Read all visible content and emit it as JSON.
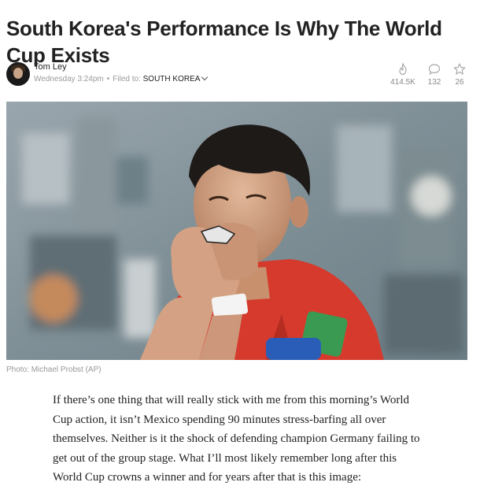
{
  "article": {
    "title": "South Korea's Performance Is Why The World Cup Exists",
    "author": "Tom Ley",
    "timestamp": "Wednesday 3:24pm",
    "separator": "•",
    "filed_label": "Filed to:",
    "filed_tag": "SOUTH KOREA",
    "stats": {
      "views": "414.5K",
      "comments": "132",
      "likes": "26"
    },
    "photo_caption": "Photo: Michael Probst (AP)",
    "body": "If there’s one thing that will really stick with me from this morning’s World Cup action, it isn’t Mexico spending 90 minutes stress-barfing all over themselves. Neither is it the shock of defending champion Germany failing to get out of the group stage. What I’ll most likely remember long after this World Cup crowns a winner and for years after that is this image:"
  },
  "icons": {
    "views": "flame-icon",
    "comments": "speech-bubble-icon",
    "likes": "star-icon"
  },
  "colors": {
    "text": "#222222",
    "meta": "#9a9a9a",
    "jersey_red": "#d53a2c"
  }
}
